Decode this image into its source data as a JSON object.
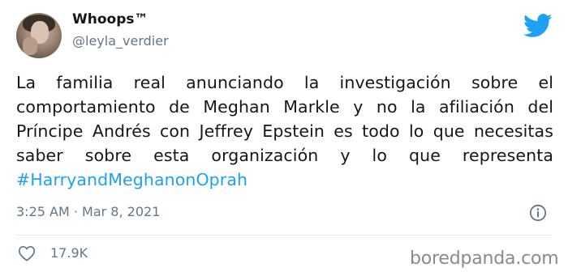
{
  "tweet": {
    "display_name": "Whoops™",
    "username": "@leyla_verdier",
    "text": "La familia real anunciando la investigación sobre el comportamiento de Meghan Markle y no la afiliación del Príncipe Andrés con Jeffrey Epstein es todo lo que necesitas saber sobre esta organización y lo que representa ",
    "hashtag": "#HarryandMeghanonOprah",
    "timestamp": "3:25 AM · Mar 8, 2021",
    "likes": "17.9K"
  },
  "icons": {
    "brand": "twitter-bird-icon",
    "info": "info-icon",
    "like": "heart-icon"
  },
  "colors": {
    "twitter_blue": "#1da1f2",
    "secondary_text": "#657786",
    "primary_text": "#14171a"
  },
  "watermark": "boredpanda.com"
}
